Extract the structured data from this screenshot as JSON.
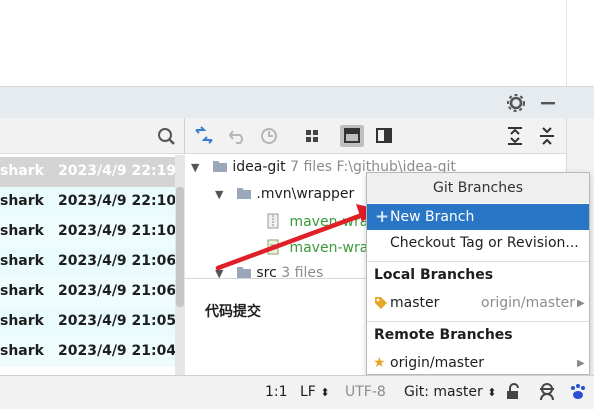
{
  "log": {
    "rows": [
      {
        "author": "shark",
        "date": "2023/4/9 22:19",
        "state": "selected"
      },
      {
        "author": "shark",
        "date": "2023/4/9 22:10",
        "state": "alt"
      },
      {
        "author": "shark",
        "date": "2023/4/9 21:10",
        "state": "plain"
      },
      {
        "author": "shark",
        "date": "2023/4/9 21:06",
        "state": "alt"
      },
      {
        "author": "shark",
        "date": "2023/4/9 21:06",
        "state": "plain"
      },
      {
        "author": "shark",
        "date": "2023/4/9 21:05",
        "state": "alt"
      },
      {
        "author": "shark",
        "date": "2023/4/9 21:04",
        "state": "plain"
      }
    ]
  },
  "tree": {
    "root": {
      "name": "idea-git",
      "meta": "7 files  F:\\github\\idea-git"
    },
    "mvn": {
      "name": ".mvn\\wrapper"
    },
    "file1": {
      "name": "maven-wrapper.jar"
    },
    "file2": {
      "name": "maven-wrapper.properties"
    },
    "src": {
      "name": "src",
      "meta": "3 files"
    }
  },
  "commit_message": "代码提交",
  "popup": {
    "title": "Git Branches",
    "new_branch": "New Branch",
    "checkout": "Checkout Tag or Revision...",
    "local_header": "Local Branches",
    "local_branch": "master",
    "local_tracking": "origin/master",
    "remote_header": "Remote Branches",
    "remote_branch": "origin/master"
  },
  "status": {
    "position": "1:1",
    "line_sep": "LF",
    "encoding": "UTF-8",
    "git": "Git: master"
  },
  "colors": {
    "accent": "#2a76c6",
    "arrow": "#e01f26",
    "file_added": "#3a9b3a"
  }
}
